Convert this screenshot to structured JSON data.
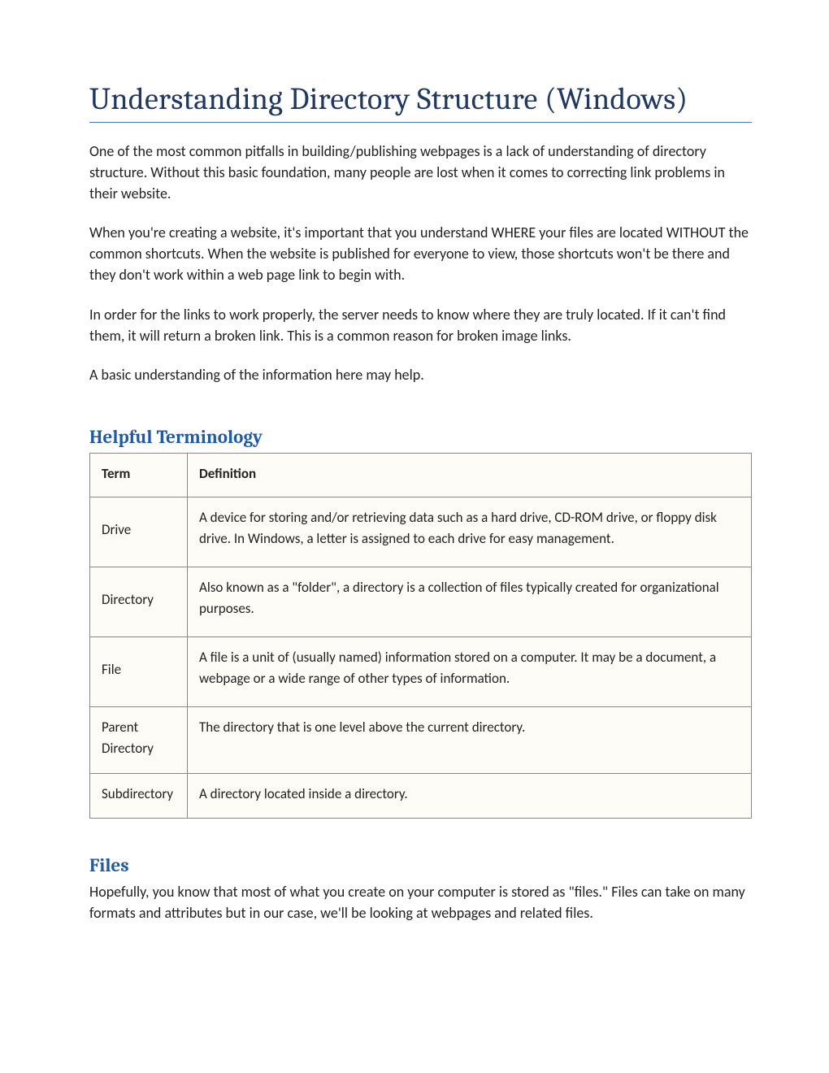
{
  "title": "Understanding Directory Structure (Windows)",
  "paragraphs": {
    "p1": "One of the most common pitfalls in building/publishing webpages is a lack of understanding of directory structure. Without this basic foundation, many people are lost when it comes to correcting link problems in their website.",
    "p2": "When you're creating a website, it's important that you understand WHERE your files are located WITHOUT the common shortcuts. When the website is published for everyone to view, those shortcuts won't be there and they don't work within a web page link to begin with.",
    "p3": "In order for the links to work properly, the server needs to know where they are truly located. If it can't find them, it will return a broken link. This is a common reason for broken image links.",
    "p4": "A basic understanding of the information here may help."
  },
  "sections": {
    "terminology_heading": "Helpful Terminology",
    "files_heading": "Files"
  },
  "table": {
    "header_term": "Term",
    "header_def": "Definition",
    "rows": [
      {
        "term": "Drive",
        "def": "A device for storing and/or retrieving data such as a hard drive, CD-ROM drive, or floppy disk drive. In Windows, a letter is assigned to each drive for easy management."
      },
      {
        "term": "Directory",
        "def": "Also known as a \"folder\", a directory is a collection of files typically created for organizational purposes."
      },
      {
        "term": "File",
        "def": "A file is a unit of (usually named) information stored on a computer. It may be a document, a webpage or a wide range of other types of information."
      },
      {
        "term": "Parent Directory",
        "def": "The directory that is one level above the current directory."
      },
      {
        "term": "Subdirectory",
        "def": "A directory located inside a directory."
      }
    ]
  },
  "files_para": "Hopefully, you know that most of what you create on your computer is stored as \"files.\" Files can take on many formats and attributes but in our case, we'll be looking at webpages and related files."
}
